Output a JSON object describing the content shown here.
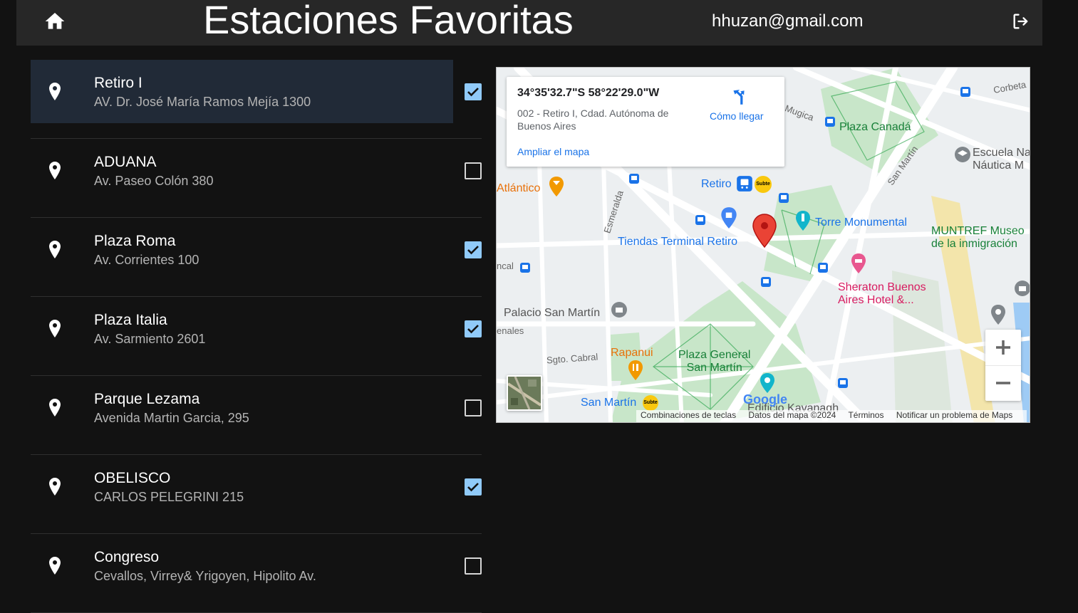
{
  "header": {
    "title": "Estaciones Favoritas",
    "user_email": "hhuzan@gmail.com"
  },
  "stations": [
    {
      "name": "Retiro I",
      "address": "AV. Dr. José María Ramos Mejía 1300",
      "favorite": true,
      "selected": true
    },
    {
      "name": "ADUANA",
      "address": "Av. Paseo Colón 380",
      "favorite": false,
      "selected": false
    },
    {
      "name": "Plaza Roma",
      "address": "Av. Corrientes 100",
      "favorite": true,
      "selected": false
    },
    {
      "name": "Plaza Italia",
      "address": "Av. Sarmiento 2601",
      "favorite": true,
      "selected": false
    },
    {
      "name": "Parque Lezama",
      "address": "Avenida Martin Garcia, 295",
      "favorite": false,
      "selected": false
    },
    {
      "name": "OBELISCO",
      "address": "CARLOS PELEGRINI 215",
      "favorite": true,
      "selected": false
    },
    {
      "name": "Congreso",
      "address": "Cevallos, Virrey& Yrigoyen, Hipolito Av.",
      "favorite": false,
      "selected": false
    }
  ],
  "map": {
    "info": {
      "coords": "34°35'32.7\"S 58°22'29.0\"W",
      "address": "002 - Retiro I, Cdad. Autónoma de Buenos Aires",
      "directions": "Cómo llegar",
      "enlarge": "Ampliar el mapa"
    },
    "labels": {
      "retiro": "Retiro",
      "subte": "Subte",
      "atlantico": "Atlántico",
      "tiendas": "Tiendas Terminal Retiro",
      "torre": "Torre Monumental",
      "plaza_canada": "Plaza Canadá",
      "escuela": "Escuela Na\nNáutica M",
      "muntref": "MUNTREF Museo\nde la inmigración",
      "sheraton": "Sheraton Buenos\nAires Hotel &...",
      "palacio": "Palacio San Martín",
      "rapanui": "Rapanui",
      "plaza_general": "Plaza General\nSan Martín",
      "san_martin": "San Martín",
      "edificio": "Edificio Kavanagh",
      "sgto_cabral": "Sgto. Cabral",
      "esmeralda": "Esmeralda",
      "san_martin_road": "San Martín",
      "mugica": "Mugica",
      "corbeta": "Corbeta",
      "ncal": "ncal",
      "enales": "enales",
      "google": "Google"
    },
    "attribution": {
      "shortcuts": "Combinaciones de teclas",
      "data": "Datos del mapa ©2024",
      "terms": "Términos",
      "report": "Notificar un problema de Maps"
    },
    "colors": {
      "park": "#c8e6c9",
      "road": "#ffffff",
      "marker": "#ea4335",
      "transit": "#1a73e8"
    }
  }
}
